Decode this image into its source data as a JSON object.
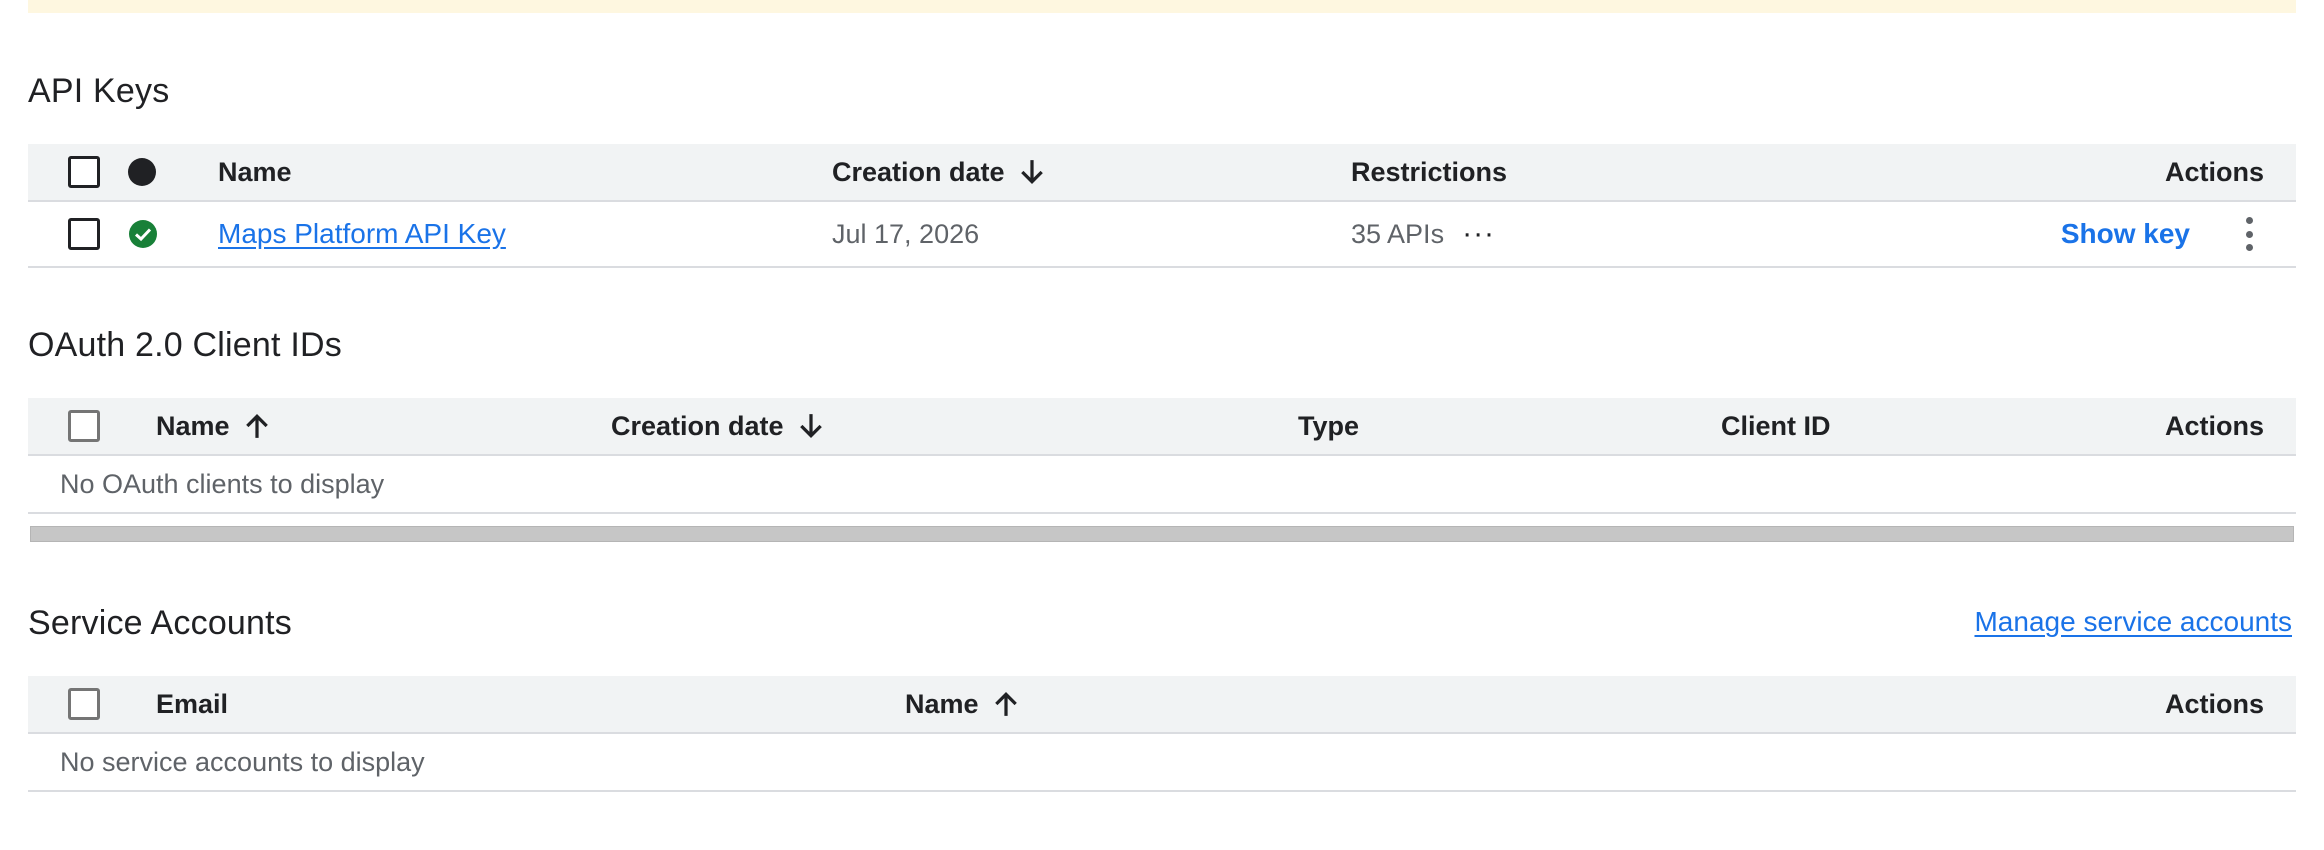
{
  "api_keys": {
    "title": "API Keys",
    "headers": {
      "name": "Name",
      "creation_date": "Creation date",
      "restrictions": "Restrictions",
      "actions": "Actions"
    },
    "rows": [
      {
        "name": "Maps Platform API Key",
        "creation_date": "Jul 17, 2026",
        "restrictions": "35 APIs",
        "more": "···",
        "action": "Show key"
      }
    ]
  },
  "oauth": {
    "title": "OAuth 2.0 Client IDs",
    "headers": {
      "name": "Name",
      "creation_date": "Creation date",
      "type": "Type",
      "client_id": "Client ID",
      "actions": "Actions"
    },
    "empty_text": "No OAuth clients to display"
  },
  "service_accounts": {
    "title": "Service Accounts",
    "manage_link": "Manage service accounts",
    "headers": {
      "email": "Email",
      "name": "Name",
      "actions": "Actions"
    },
    "empty_text": "No service accounts to display"
  },
  "colors": {
    "accent": "#1a73e8",
    "success": "#188038",
    "header_bg": "#f1f3f4",
    "banner_bg": "#fef7e0"
  },
  "icons": {
    "status_ok": "check-circle-icon",
    "sort_up": "arrow-up-icon",
    "sort_down": "arrow-down-icon",
    "more": "more-horiz-icon",
    "kebab": "more-vert-icon"
  }
}
